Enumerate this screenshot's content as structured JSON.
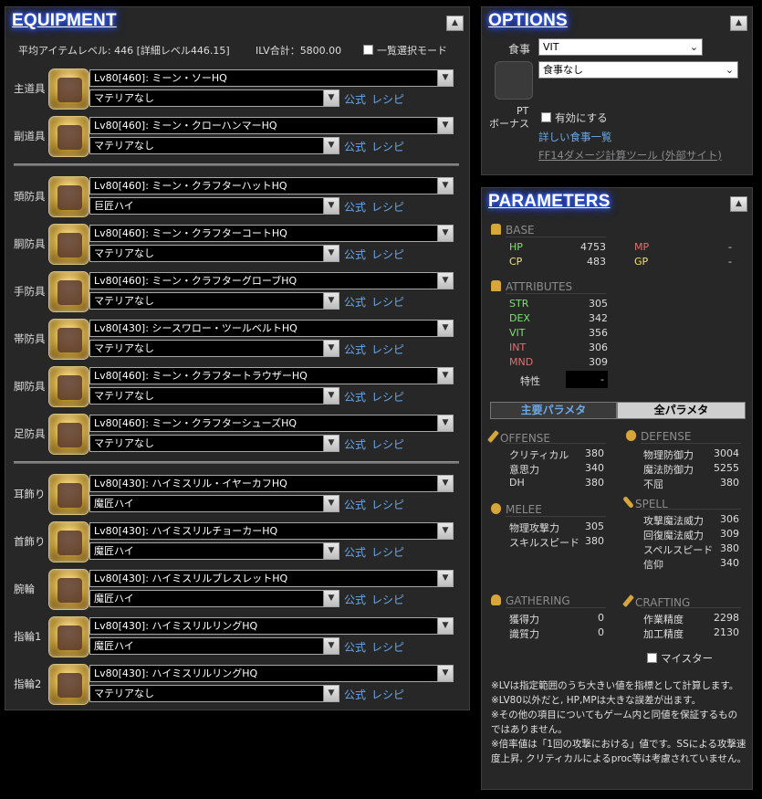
{
  "equipment": {
    "title": "EQUIPMENT",
    "collapse_icon": "▲",
    "avg_item_level": "平均アイテムレベル: 446 [詳細レベル446.15]",
    "ilv_total": "ILV合計：5800.00",
    "list_mode_label": "一覧選択モード",
    "link_official": "公式",
    "link_recipe": "レシピ",
    "slots": [
      {
        "name": "主道具",
        "item": "Lv80[460]: ミーン・ソーHQ",
        "materia": "マテリアなし"
      },
      {
        "name": "副道具",
        "item": "Lv80[460]: ミーン・クローハンマーHQ",
        "materia": "マテリアなし"
      },
      {
        "name": "頭防具",
        "item": "Lv80[460]: ミーン・クラフターハットHQ",
        "materia": "巨匠ハイ"
      },
      {
        "name": "胴防具",
        "item": "Lv80[460]: ミーン・クラフターコートHQ",
        "materia": "マテリアなし"
      },
      {
        "name": "手防具",
        "item": "Lv80[460]: ミーン・クラフターグローブHQ",
        "materia": "マテリアなし"
      },
      {
        "name": "帯防具",
        "item": "Lv80[430]: シースワロー・ツールベルトHQ",
        "materia": "マテリアなし"
      },
      {
        "name": "脚防具",
        "item": "Lv80[460]: ミーン・クラフタートラウザーHQ",
        "materia": "マテリアなし"
      },
      {
        "name": "足防具",
        "item": "Lv80[460]: ミーン・クラフターシューズHQ",
        "materia": "マテリアなし"
      },
      {
        "name": "耳飾り",
        "item": "Lv80[430]: ハイミスリル・イヤーカフHQ",
        "materia": "魔匠ハイ"
      },
      {
        "name": "首飾り",
        "item": "Lv80[430]: ハイミスリルチョーカーHQ",
        "materia": "魔匠ハイ"
      },
      {
        "name": "腕輪",
        "item": "Lv80[430]: ハイミスリルブレスレットHQ",
        "materia": "魔匠ハイ"
      },
      {
        "name": "指輪1",
        "item": "Lv80[430]: ハイミスリルリングHQ",
        "materia": "魔匠ハイ"
      },
      {
        "name": "指輪2",
        "item": "Lv80[430]: ハイミスリルリングHQ",
        "materia": "マテリアなし"
      }
    ]
  },
  "options": {
    "title": "OPTIONS",
    "food_label": "食事",
    "food_type_value": "VIT",
    "food_value": "食事なし",
    "pt_bonus_label_1": "PT",
    "pt_bonus_label_2": "ボーナス",
    "enable_label": "有効にする",
    "food_list_link": "詳しい食事一覧",
    "ff14_link": "FF14ダメージ計算ツール (外部サイト)"
  },
  "parameters": {
    "title": "PARAMETERS",
    "base_label": "BASE",
    "hp_label": "HP",
    "hp_value": "4753",
    "mp_label": "MP",
    "mp_value": "-",
    "cp_label": "CP",
    "cp_value": "483",
    "gp_label": "GP",
    "gp_value": "-",
    "attributes_label": "ATTRIBUTES",
    "str_label": "STR",
    "str_value": "305",
    "dex_label": "DEX",
    "dex_value": "342",
    "vit_label": "VIT",
    "vit_value": "356",
    "int_label": "INT",
    "int_value": "306",
    "mnd_label": "MND",
    "mnd_value": "309",
    "trait_label": "特性",
    "trait_value": "-",
    "tab_main": "主要パラメタ",
    "tab_all": "全パラメタ",
    "offense_label": "OFFENSE",
    "crit_label": "クリティカル",
    "crit_value": "380",
    "det_label": "意思力",
    "det_value": "340",
    "dh_label": "DH",
    "dh_value": "380",
    "defense_label": "DEFENSE",
    "pdef_label": "物理防御力",
    "pdef_value": "3004",
    "mdef_label": "魔法防御力",
    "mdef_value": "5255",
    "tenacity_label": "不屈",
    "tenacity_value": "380",
    "melee_label": "MELEE",
    "atk_label": "物理攻撃力",
    "atk_value": "305",
    "sks_label": "スキルスピード",
    "sks_value": "380",
    "spell_label": "SPELL",
    "matk_label": "攻撃魔法威力",
    "matk_value": "306",
    "heal_label": "回復魔法威力",
    "heal_value": "309",
    "sps_label": "スペルスピード",
    "sps_value": "380",
    "piety_label": "信仰",
    "piety_value": "340",
    "gathering_label": "GATHERING",
    "gathering_label_1": "獲得力",
    "gathering_value_1": "0",
    "perception_label": "識質力",
    "perception_value": "0",
    "crafting_label": "CRAFTING",
    "craftsmanship_label": "作業精度",
    "craftsmanship_value": "2298",
    "control_label": "加工精度",
    "control_value": "2130",
    "meister_label": "マイスター",
    "notes": [
      "※LVは指定範囲のうち大きい値を指標として計算します。",
      "※LV80以外だと, HP,MPは大きな誤差が出ます。",
      "※その他の項目についてもゲーム内と同値を保証するもの",
      "ではありません。",
      "※倍率値は「1回の攻撃における」値です。SSによる攻撃速",
      "度上昇, クリティカルによるproc等は考慮されていません。"
    ]
  },
  "colors": {
    "hp": "#7be36f",
    "cp": "#f4e06a",
    "mp": "#e07070",
    "gp": "#f4e06a",
    "str": "#7be36f",
    "dex": "#7be36f",
    "vit": "#7be36f",
    "int": "#e07070",
    "mnd": "#e07070",
    "link": "#6aa8e8",
    "title_glow": "#2a55ff"
  }
}
